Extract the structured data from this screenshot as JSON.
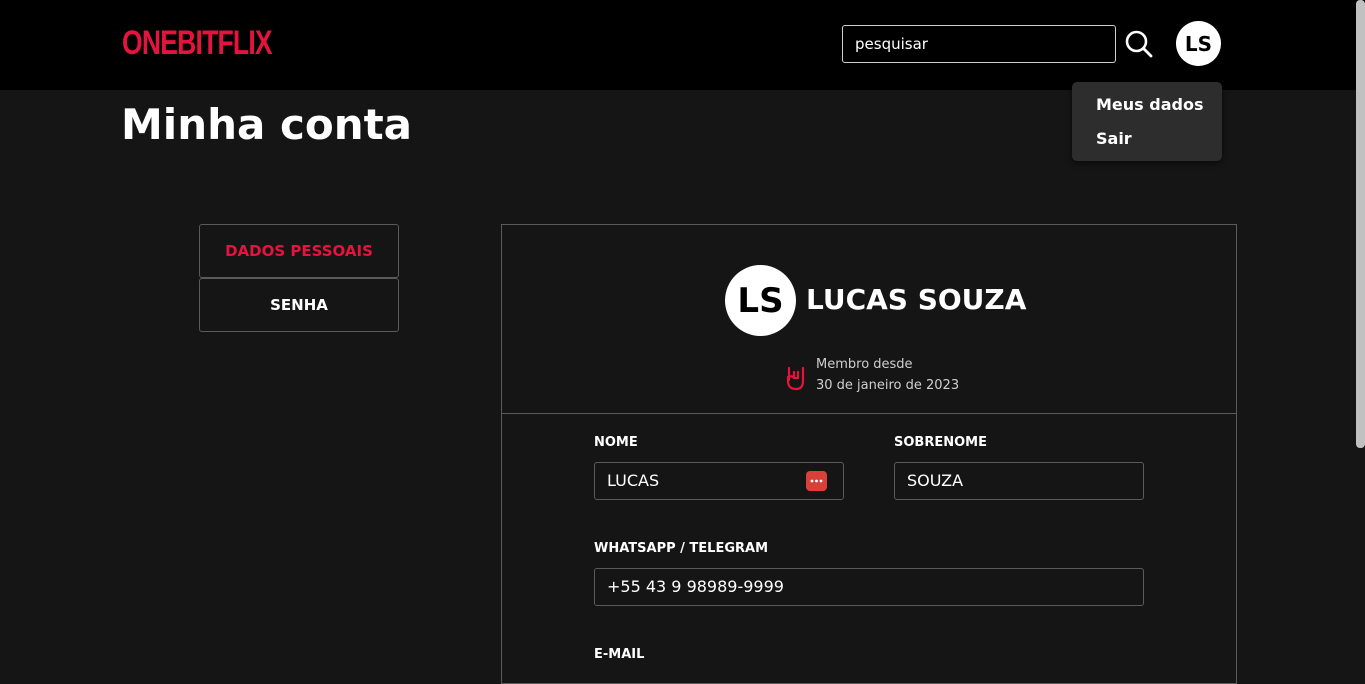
{
  "header": {
    "logo": "ONEBITFLIX",
    "search": {
      "value": "pesquisar"
    },
    "avatar_initials": "LS"
  },
  "dropdown": {
    "items": [
      "Meus dados",
      "Sair"
    ]
  },
  "page": {
    "title": "Minha conta"
  },
  "tabs": [
    {
      "label": "DADOS PESSOAIS",
      "active": true
    },
    {
      "label": "SENHA",
      "active": false
    }
  ],
  "profile": {
    "initials": "LS",
    "name": "LUCAS SOUZA",
    "member_label": "Membro desde",
    "member_date": "30 de janeiro de 2023"
  },
  "form": {
    "first_name": {
      "label": "NOME",
      "value": "LUCAS"
    },
    "last_name": {
      "label": "SOBRENOME",
      "value": "SOUZA"
    },
    "phone": {
      "label": "WHATSAPP / TELEGRAM",
      "value": "+55 43 9 98989-9999"
    },
    "email": {
      "label": "E-MAIL"
    }
  },
  "colors": {
    "accent": "#e5133d",
    "background": "#151515",
    "header": "#000000"
  }
}
